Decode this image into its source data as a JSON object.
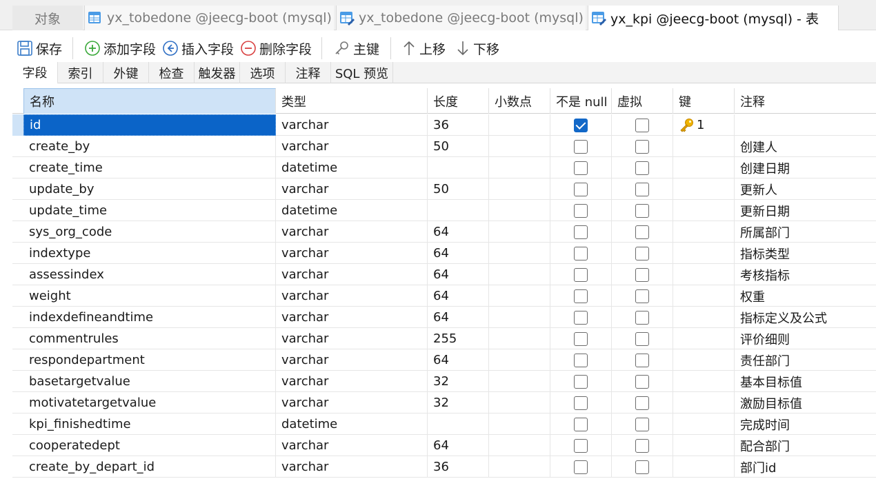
{
  "doc_tabs": [
    {
      "label": "对象"
    },
    {
      "label": "yx_tobedone @jeecg-boot (mysql) -..."
    },
    {
      "label": "yx_tobedone @jeecg-boot (mysql) -..."
    },
    {
      "label": "yx_kpi @jeecg-boot (mysql) - 表"
    }
  ],
  "toolbar": {
    "save": "保存",
    "add_field": "添加字段",
    "insert_field": "插入字段",
    "delete_field": "删除字段",
    "primary_key": "主键",
    "move_up": "上移",
    "move_down": "下移"
  },
  "sub_tabs": [
    "字段",
    "索引",
    "外键",
    "检查",
    "触发器",
    "选项",
    "注释",
    "SQL 预览"
  ],
  "columns": [
    "名称",
    "类型",
    "长度",
    "小数点",
    "不是 null",
    "虚拟",
    "键",
    "注释"
  ],
  "rows": [
    {
      "name": "id",
      "type": "varchar",
      "length": "36",
      "decimals": "",
      "not_null": true,
      "virtual": false,
      "key": "1",
      "comment": ""
    },
    {
      "name": "create_by",
      "type": "varchar",
      "length": "50",
      "decimals": "",
      "not_null": false,
      "virtual": false,
      "key": "",
      "comment": "创建人"
    },
    {
      "name": "create_time",
      "type": "datetime",
      "length": "",
      "decimals": "",
      "not_null": false,
      "virtual": false,
      "key": "",
      "comment": "创建日期"
    },
    {
      "name": "update_by",
      "type": "varchar",
      "length": "50",
      "decimals": "",
      "not_null": false,
      "virtual": false,
      "key": "",
      "comment": "更新人"
    },
    {
      "name": "update_time",
      "type": "datetime",
      "length": "",
      "decimals": "",
      "not_null": false,
      "virtual": false,
      "key": "",
      "comment": "更新日期"
    },
    {
      "name": "sys_org_code",
      "type": "varchar",
      "length": "64",
      "decimals": "",
      "not_null": false,
      "virtual": false,
      "key": "",
      "comment": "所属部门"
    },
    {
      "name": "indextype",
      "type": "varchar",
      "length": "64",
      "decimals": "",
      "not_null": false,
      "virtual": false,
      "key": "",
      "comment": "指标类型"
    },
    {
      "name": "assessindex",
      "type": "varchar",
      "length": "64",
      "decimals": "",
      "not_null": false,
      "virtual": false,
      "key": "",
      "comment": "考核指标"
    },
    {
      "name": "weight",
      "type": "varchar",
      "length": "64",
      "decimals": "",
      "not_null": false,
      "virtual": false,
      "key": "",
      "comment": "权重"
    },
    {
      "name": "indexdefineandtime",
      "type": "varchar",
      "length": "64",
      "decimals": "",
      "not_null": false,
      "virtual": false,
      "key": "",
      "comment": "指标定义及公式"
    },
    {
      "name": "commentrules",
      "type": "varchar",
      "length": "255",
      "decimals": "",
      "not_null": false,
      "virtual": false,
      "key": "",
      "comment": "评价细则"
    },
    {
      "name": "respondepartment",
      "type": "varchar",
      "length": "64",
      "decimals": "",
      "not_null": false,
      "virtual": false,
      "key": "",
      "comment": "责任部门"
    },
    {
      "name": "basetargetvalue",
      "type": "varchar",
      "length": "32",
      "decimals": "",
      "not_null": false,
      "virtual": false,
      "key": "",
      "comment": "基本目标值"
    },
    {
      "name": "motivatetargetvalue",
      "type": "varchar",
      "length": "32",
      "decimals": "",
      "not_null": false,
      "virtual": false,
      "key": "",
      "comment": "激励目标值"
    },
    {
      "name": "kpi_finishedtime",
      "type": "datetime",
      "length": "",
      "decimals": "",
      "not_null": false,
      "virtual": false,
      "key": "",
      "comment": "完成时间"
    },
    {
      "name": "cooperatedept",
      "type": "varchar",
      "length": "64",
      "decimals": "",
      "not_null": false,
      "virtual": false,
      "key": "",
      "comment": "配合部门"
    },
    {
      "name": "create_by_depart_id",
      "type": "varchar",
      "length": "36",
      "decimals": "",
      "not_null": false,
      "virtual": false,
      "key": "",
      "comment": "部门id"
    }
  ],
  "colors": {
    "selection": "#0b64c8",
    "header_selected": "#cfe3f7",
    "checkbox_checked": "#1268c8"
  }
}
